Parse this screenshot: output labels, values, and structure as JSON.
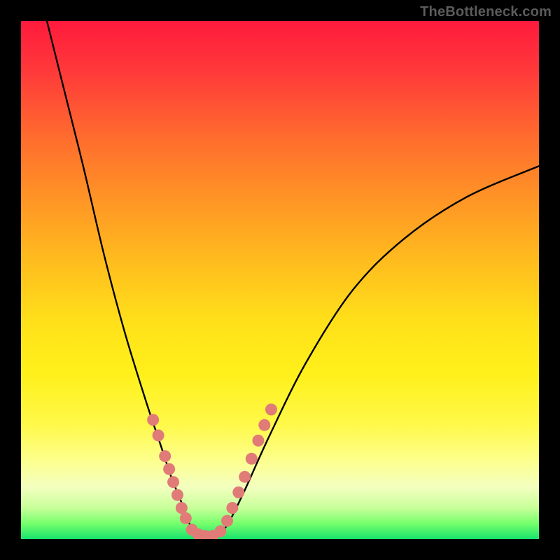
{
  "watermark": "TheBottleneck.com",
  "colors": {
    "background_frame": "#000000",
    "gradient_top": "#ff1a3c",
    "gradient_bottom": "#19e36c",
    "curve_stroke": "#000000",
    "dot_fill": "#e07b78"
  },
  "chart_data": {
    "type": "line",
    "title": "",
    "xlabel": "",
    "ylabel": "",
    "xlim": [
      0,
      100
    ],
    "ylim": [
      0,
      100
    ],
    "series": [
      {
        "name": "left-branch",
        "x": [
          5,
          8,
          12,
          16,
          20,
          24,
          27,
          29,
          31,
          32.5,
          34
        ],
        "values": [
          100,
          88,
          72,
          55,
          40,
          27,
          18,
          12,
          7,
          3,
          0.5
        ]
      },
      {
        "name": "right-branch",
        "x": [
          38,
          40,
          43,
          48,
          55,
          64,
          74,
          86,
          100
        ],
        "values": [
          0.5,
          3,
          9,
          20,
          34,
          48,
          58,
          66,
          72
        ]
      }
    ],
    "markers": {
      "description": "salmon dots clustered near valley on both branches",
      "points": [
        {
          "x": 25.5,
          "y": 23
        },
        {
          "x": 26.5,
          "y": 20
        },
        {
          "x": 27.8,
          "y": 16
        },
        {
          "x": 28.6,
          "y": 13.5
        },
        {
          "x": 29.4,
          "y": 11
        },
        {
          "x": 30.2,
          "y": 8.5
        },
        {
          "x": 31.0,
          "y": 6
        },
        {
          "x": 31.8,
          "y": 4
        },
        {
          "x": 33.0,
          "y": 1.8
        },
        {
          "x": 34.2,
          "y": 0.9
        },
        {
          "x": 35.5,
          "y": 0.6
        },
        {
          "x": 37.0,
          "y": 0.6
        },
        {
          "x": 38.5,
          "y": 1.5
        },
        {
          "x": 39.8,
          "y": 3.5
        },
        {
          "x": 40.8,
          "y": 6
        },
        {
          "x": 42.0,
          "y": 9
        },
        {
          "x": 43.2,
          "y": 12
        },
        {
          "x": 44.5,
          "y": 15.5
        },
        {
          "x": 45.8,
          "y": 19
        },
        {
          "x": 47.0,
          "y": 22
        },
        {
          "x": 48.3,
          "y": 25
        }
      ]
    }
  }
}
